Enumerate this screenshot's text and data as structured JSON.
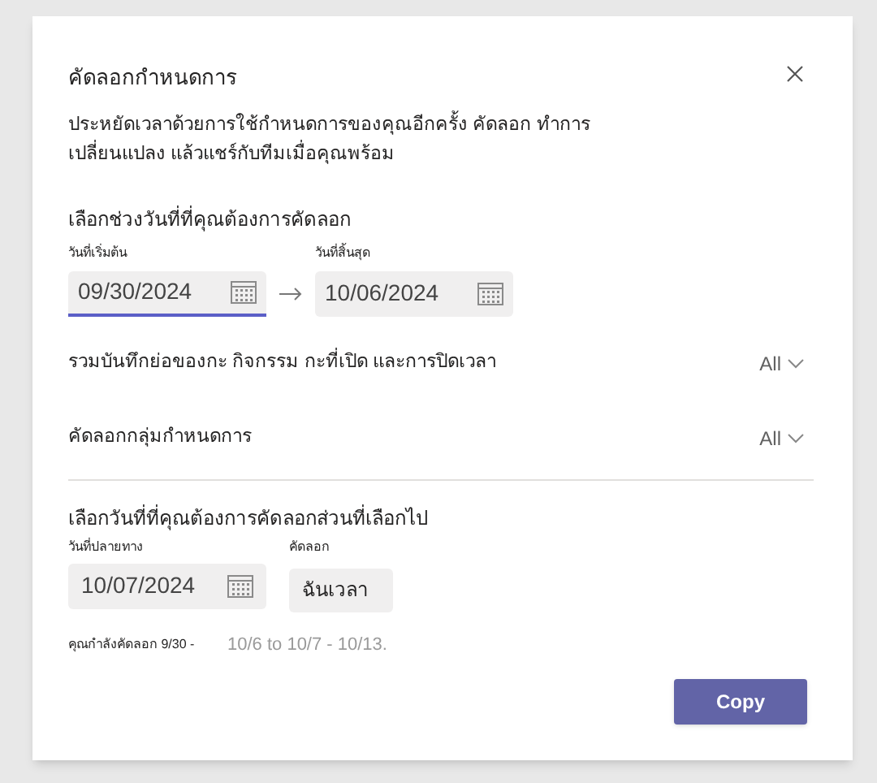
{
  "dialog": {
    "title": "คัดลอกกำหนดการ",
    "description": "ประหยัดเวลาด้วยการใช้กำหนดการของคุณอีกครั้ง คัดลอก ทำการเปลี่ยนแปลง แล้วแชร์กับทีมเมื่อคุณพร้อม"
  },
  "range_section": {
    "heading": "เลือกช่วงวันที่ที่คุณต้องการคัดลอก",
    "start": {
      "label": "วันที่เริ่มต้น",
      "value": "09/30/2024",
      "focused": true
    },
    "end": {
      "label": "วันที่สิ้นสุด",
      "value": "10/06/2024",
      "focused": false
    }
  },
  "options": [
    {
      "label": "รวมบันทึกย่อของกะ กิจกรรม กะที่เปิด และการปิดเวลา",
      "value": "All"
    },
    {
      "label": "คัดลอกกลุ่มกำหนดการ",
      "value": "All"
    }
  ],
  "target_section": {
    "heading": "เลือกวันที่ที่คุณต้องการคัดลอกส่วนที่เลือกไป",
    "date": {
      "label": "วันที่ปลายทาง",
      "value": "10/07/2024"
    },
    "copy": {
      "label": "คัดลอก",
      "value": "ฉันเวลา"
    },
    "summary_label": "คุณกำลังคัดลอก 9/30 -",
    "summary_value": "10/6 to 10/7 - 10/13."
  },
  "buttons": [
    "Copy"
  ]
}
